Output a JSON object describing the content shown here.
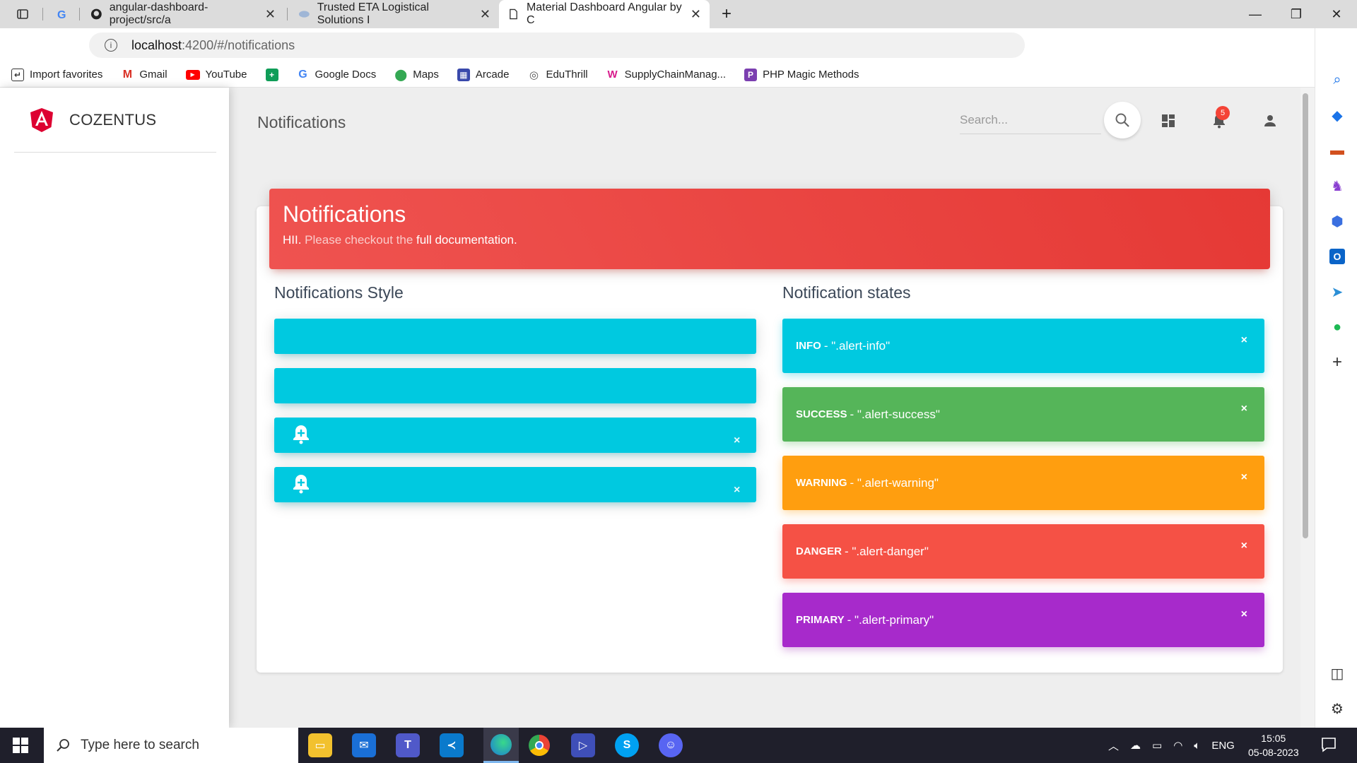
{
  "browser": {
    "tabs": [
      {
        "title": "",
        "favicon": "google"
      },
      {
        "title": "angular-dashboard-project/src/a",
        "favicon": "github"
      },
      {
        "title": "Trusted ETA Logistical Solutions I",
        "favicon": "eta"
      },
      {
        "title": "Material Dashboard Angular by C",
        "favicon": "page",
        "active": true
      }
    ],
    "url_host": "localhost",
    "url_path": ":4200/#/notifications",
    "favorites": [
      {
        "label": "Import favorites",
        "icon": "import-icon"
      },
      {
        "label": "Gmail",
        "icon": "gmail-icon"
      },
      {
        "label": "YouTube",
        "icon": "youtube-icon"
      },
      {
        "label": "",
        "icon": "sheets-icon"
      },
      {
        "label": "Google Docs",
        "icon": "google-icon"
      },
      {
        "label": "Maps",
        "icon": "maps-icon"
      },
      {
        "label": "Arcade",
        "icon": "arcade-icon"
      },
      {
        "label": "EduThrill",
        "icon": "eduthrill-icon"
      },
      {
        "label": "SupplyChainManag...",
        "icon": "supplychain-icon"
      },
      {
        "label": "PHP Magic Methods",
        "icon": "php-icon"
      }
    ]
  },
  "sidebar": {
    "brand": "COZENTUS"
  },
  "navbar": {
    "title": "Notifications",
    "search_placeholder": "Search...",
    "badge_count": "5"
  },
  "card": {
    "title": "Notifications",
    "category_hi": "HII.",
    "category_text": " Please checkout the ",
    "category_link": "full documentation."
  },
  "styles_column": {
    "title": "Notifications Style"
  },
  "states_column": {
    "title": "Notification states",
    "states": [
      {
        "type": "INFO",
        "text": " - \".alert-info\"",
        "close": "×"
      },
      {
        "type": "SUCCESS",
        "text": " - \".alert-success\"",
        "close": "×"
      },
      {
        "type": "WARNING",
        "text": " - \".alert-warning\"",
        "close": "×"
      },
      {
        "type": "DANGER",
        "text": " - \".alert-danger\"",
        "close": "×"
      },
      {
        "type": "PRIMARY",
        "text": " - \".alert-primary\"",
        "close": "×"
      }
    ]
  },
  "style_alerts": {
    "close": "×"
  },
  "taskbar": {
    "search_placeholder": "Type here to search",
    "language": "ENG",
    "time": "15:05",
    "date": "05-08-2023"
  },
  "colors": {
    "info": "#00c9e0",
    "success": "#55b559",
    "warning": "#ff9e0f",
    "danger": "#f55145",
    "primary": "#a72acb",
    "header": "#e53935"
  }
}
